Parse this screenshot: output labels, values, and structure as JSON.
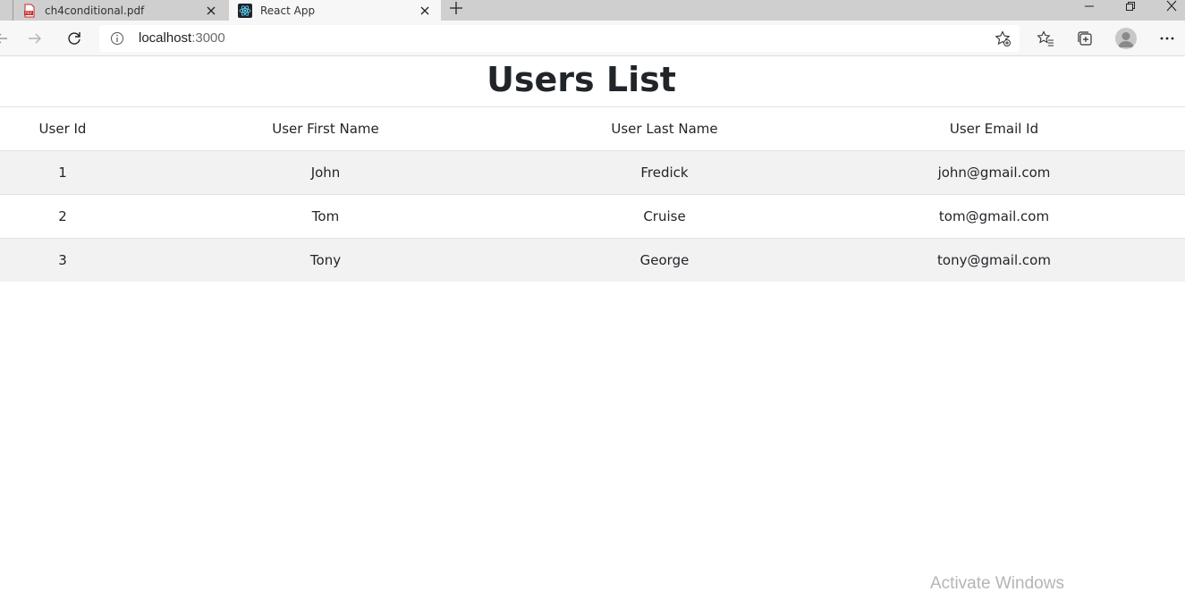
{
  "browser": {
    "tabs": [
      {
        "title": "ch4conditional.pdf",
        "icon": "pdf-icon",
        "active": false
      },
      {
        "title": "React App",
        "icon": "react-logo-icon",
        "active": true
      }
    ],
    "address": {
      "host": "localhost",
      "port": ":3000"
    }
  },
  "page": {
    "title": "Users List",
    "table": {
      "headers": [
        "User Id",
        "User First Name",
        "User Last Name",
        "User Email Id"
      ],
      "rows": [
        [
          "1",
          "John",
          "Fredick",
          "john@gmail.com"
        ],
        [
          "2",
          "Tom",
          "Cruise",
          "tom@gmail.com"
        ],
        [
          "3",
          "Tony",
          "George",
          "tony@gmail.com"
        ]
      ]
    }
  },
  "watermark": "Activate Windows"
}
